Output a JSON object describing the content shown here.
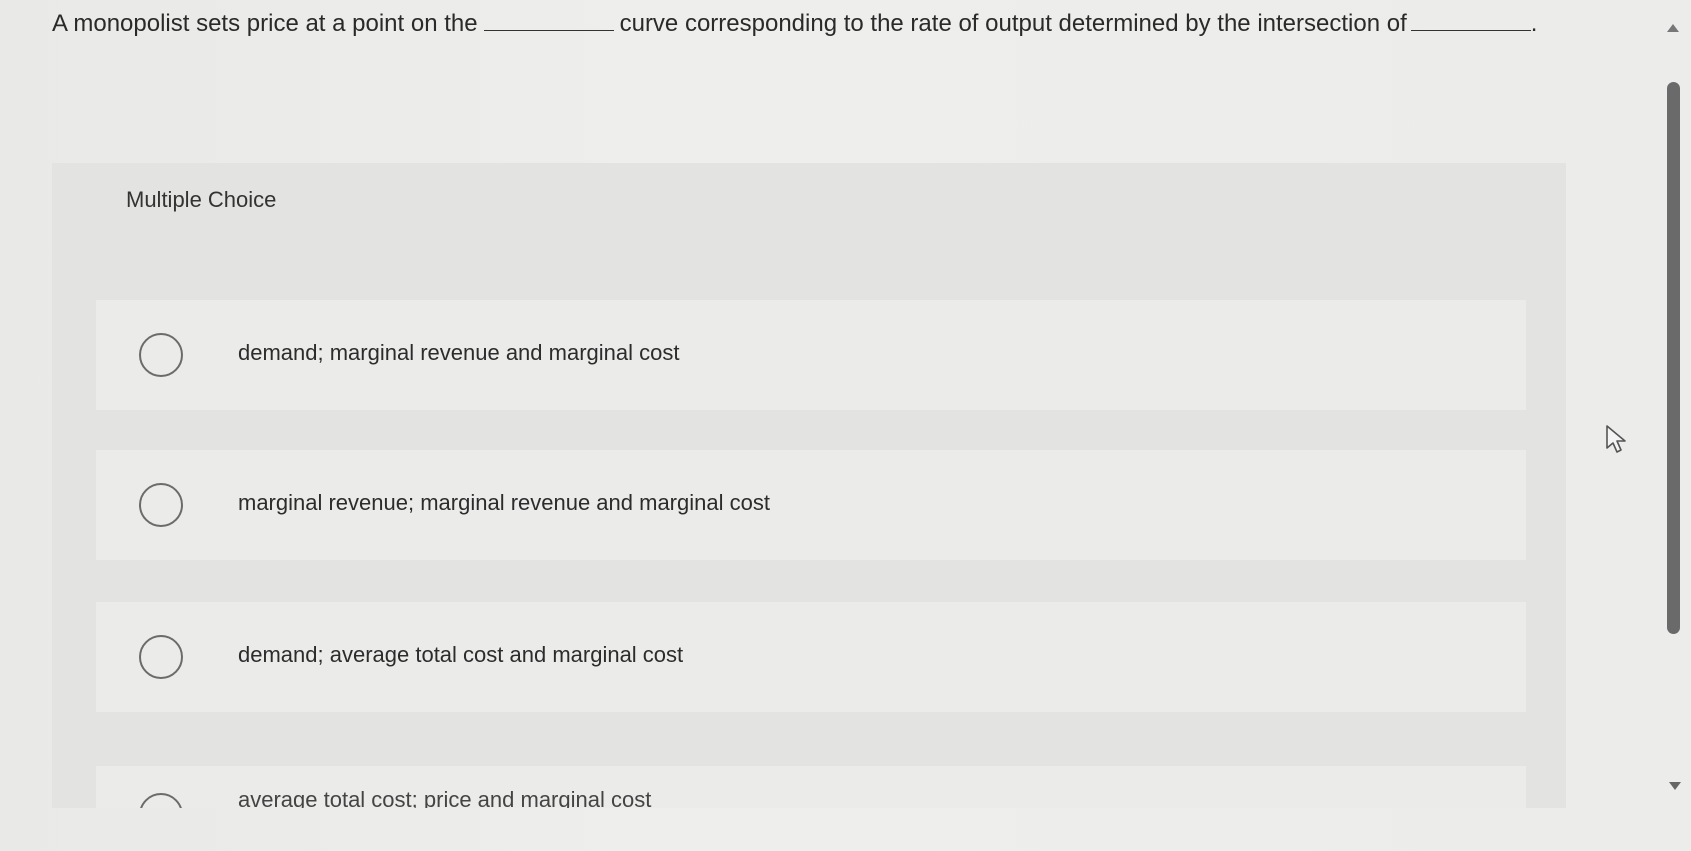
{
  "question": {
    "part1": "A monopolist sets price at a point on the",
    "part2": "curve corresponding to the rate of output determined by the intersection of",
    "part3": "."
  },
  "section_label": "Multiple Choice",
  "choices": [
    {
      "label": "demand; marginal revenue and marginal cost"
    },
    {
      "label": "marginal revenue; marginal revenue and marginal cost"
    },
    {
      "label": "demand; average total cost and marginal cost"
    },
    {
      "label": "average total cost; price and marginal cost"
    }
  ],
  "icons": {
    "radio": "radio-empty-icon",
    "cursor": "mouse-pointer-icon",
    "scroll_up": "triangle-up-icon",
    "scroll_down": "triangle-down-icon"
  }
}
